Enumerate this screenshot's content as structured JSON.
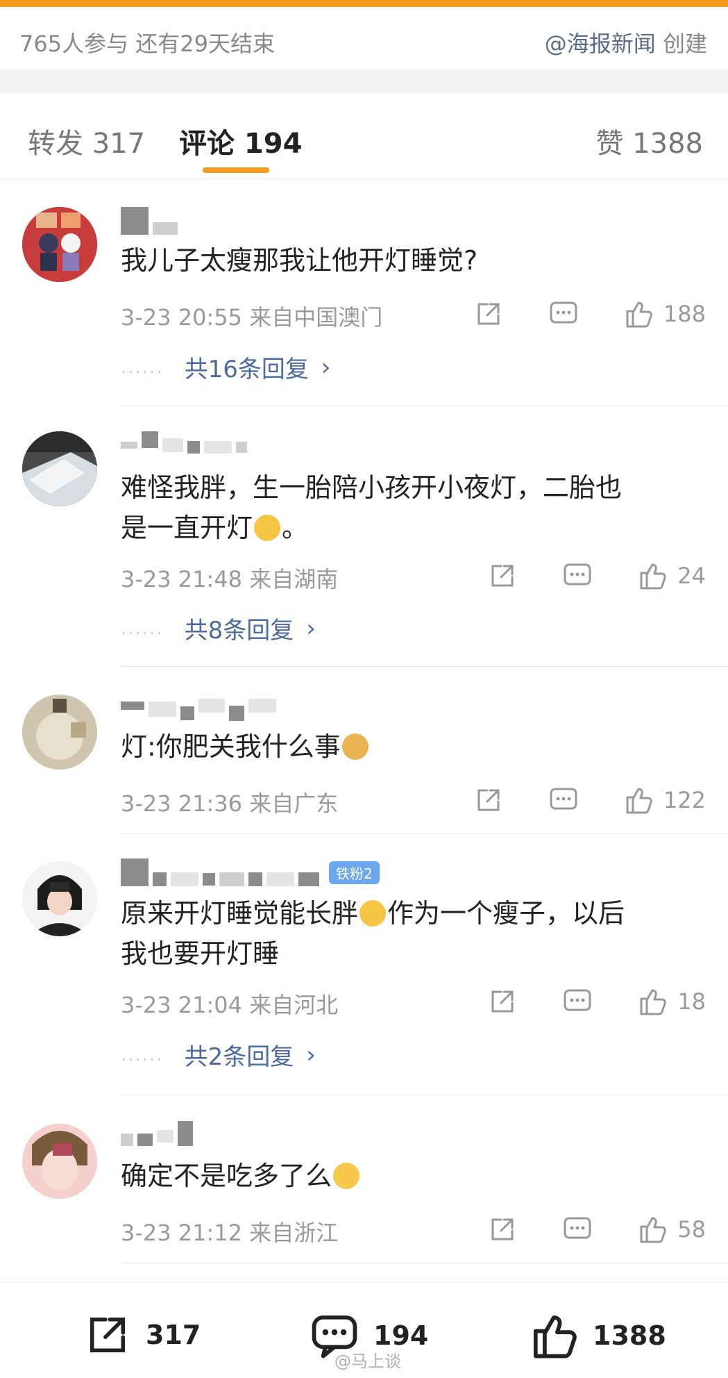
{
  "topic": {
    "participants": "765人参与  还有29天结束",
    "creator_handle": "@海报新闻",
    "creator_suffix": " 创建"
  },
  "tabs": [
    {
      "label": "转发 317"
    },
    {
      "label": "评论 194"
    },
    {
      "label": "赞 1388"
    }
  ],
  "comments": [
    {
      "text": "我儿子太瘦那我让他开灯睡觉?",
      "time": "3-23 20:55",
      "location": "来自中国澳门",
      "likes": "188",
      "replies": "共16条回复",
      "emoji": ""
    },
    {
      "text_line1": "难怪我胖，生一胎陪小孩开小夜灯，二胎也",
      "text_line2a": "是一直开灯",
      "text_line2b": "。",
      "time": "3-23 21:48",
      "location": "来自湖南",
      "likes": "24",
      "replies": "共8条回复",
      "emoji": "crying-laughing-emoji"
    },
    {
      "text": "灯:你肥关我什么事",
      "time": "3-23 21:36",
      "location": "来自广东",
      "likes": "122",
      "emoji": "doge-emoji"
    },
    {
      "text_line1a": "原来开灯睡觉能长胖",
      "text_line1b": "作为一个瘦子，以后",
      "text_line2": "我也要开灯睡",
      "badge": "铁粉2",
      "time": "3-23 21:04",
      "location": "来自河北",
      "likes": "18",
      "replies": "共2条回复",
      "emoji": "laughing-tears-emoji"
    },
    {
      "text": "确定不是吃多了么",
      "time": "3-23 21:12",
      "location": "来自浙江",
      "likes": "58",
      "emoji": "hug-emoji"
    }
  ],
  "bottom_bar": {
    "reposts": "317",
    "comments": "194",
    "likes": "1388"
  },
  "watermark": "@马上谈",
  "colors": {
    "accent": "#f59a1c",
    "link": "#4a6aa0",
    "meta": "#9a9a9a",
    "badge": "#6aa7ee"
  }
}
